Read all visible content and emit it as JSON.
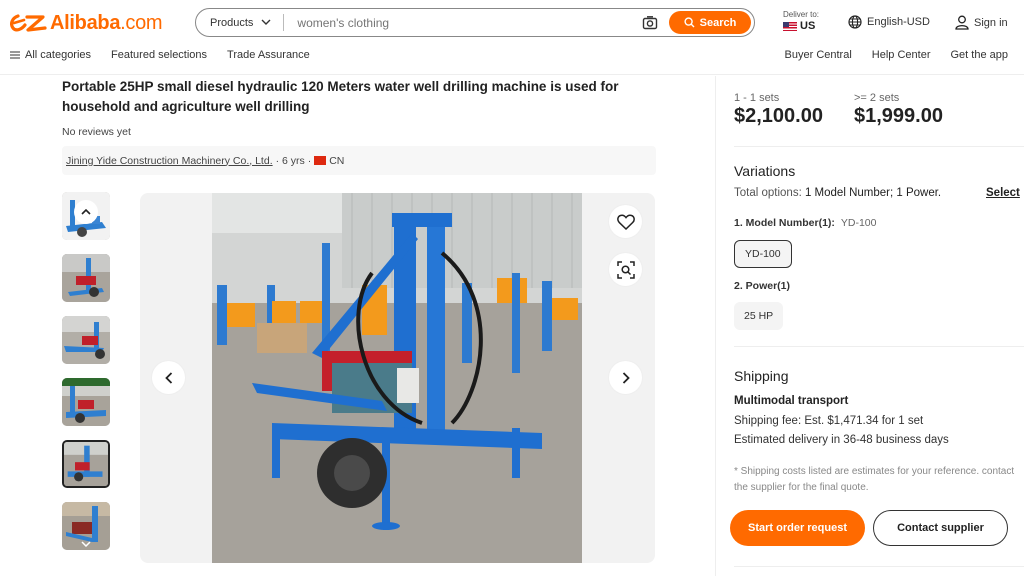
{
  "header": {
    "logo_text": "Alibaba",
    "logo_suffix": ".com",
    "search": {
      "category": "Products",
      "placeholder": "women's clothing",
      "button_label": "Search"
    },
    "deliver": {
      "label": "Deliver to:",
      "country": "US"
    },
    "language": "English-USD",
    "sign_in": "Sign in",
    "nav_left": [
      "All categories",
      "Featured selections",
      "Trade Assurance"
    ],
    "nav_right": [
      "Buyer Central",
      "Help Center",
      "Get the app"
    ],
    "brand_color": "#ff6a00"
  },
  "product": {
    "title": "Portable 25HP small diesel hydraulic 120 Meters water well drilling machine is used for household and agriculture well drilling",
    "reviews": "No reviews yet",
    "supplier": {
      "name": "Jining Yide Construction Machinery Co., Ltd.",
      "years": "· 6 yrs ·",
      "country": "CN"
    },
    "thumbnail_count": 6,
    "selected_thumbnail": 5
  },
  "pricing": {
    "tiers": [
      {
        "qty": "1 - 1 sets",
        "price": "$2,100.00"
      },
      {
        "qty": ">= 2 sets",
        "price": "$1,999.00"
      }
    ]
  },
  "variations": {
    "title": "Variations",
    "total_prefix": "Total options:",
    "total_value": "1 Model Number; 1 Power.",
    "select_link": "Select",
    "model": {
      "label": "1. Model Number(1):",
      "selected": "YD-100",
      "options": [
        "YD-100"
      ]
    },
    "power": {
      "label": "2. Power(1)",
      "options": [
        "25 HP"
      ]
    }
  },
  "shipping": {
    "title": "Shipping",
    "method": "Multimodal transport",
    "fee": "Shipping fee: Est. $1,471.34 for 1 set",
    "delivery": "Estimated delivery in 36-48 business days",
    "note": "* Shipping costs listed are estimates for your reference. contact the supplier for the final quote."
  },
  "actions": {
    "order": "Start order request",
    "contact": "Contact supplier"
  }
}
